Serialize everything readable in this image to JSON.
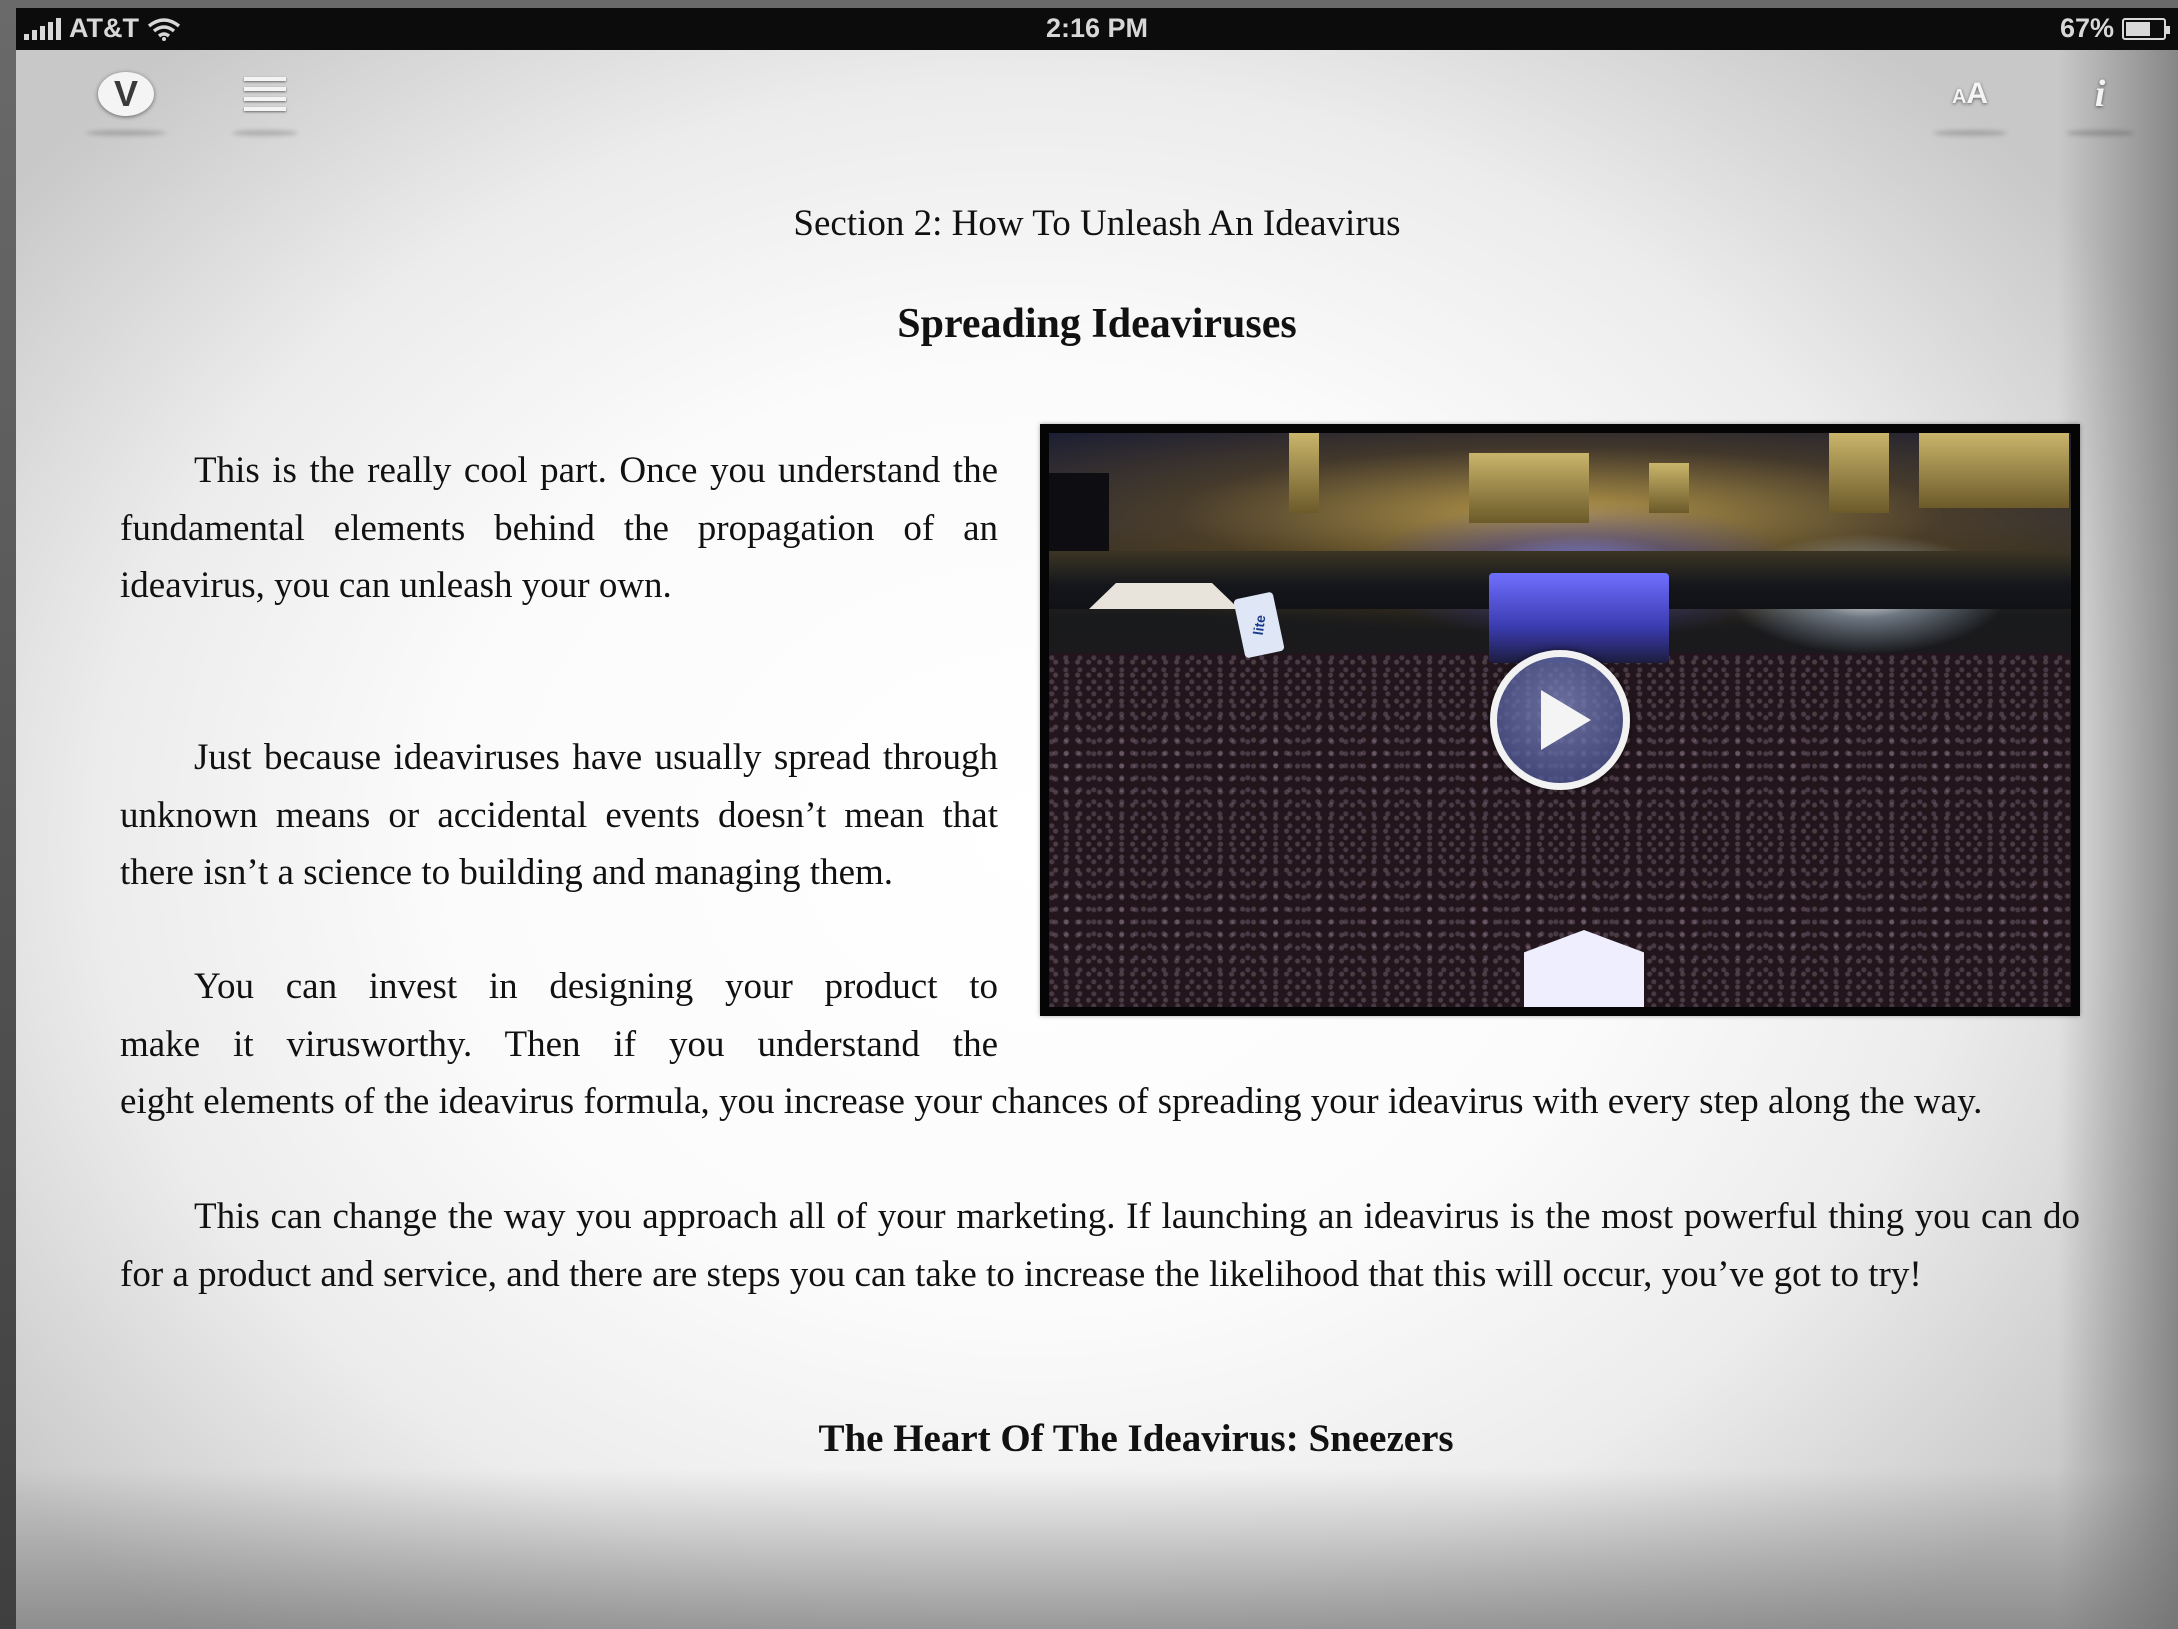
{
  "status_bar": {
    "carrier": "AT&T",
    "time": "2:16 PM",
    "battery": "67%",
    "battery_level": 0.67,
    "icons": [
      "signal-icon",
      "wifi-icon",
      "battery-icon"
    ]
  },
  "toolbar": {
    "logo_letter": "V",
    "font_small": "A",
    "font_big": "A",
    "info_label": "i",
    "icons": [
      "logo-icon",
      "table-of-contents-icon",
      "font-size-icon",
      "info-icon"
    ]
  },
  "content": {
    "section_title": "Section 2: How To Unleash An Ideavirus",
    "chapter_title": "Spreading Ideaviruses",
    "paragraphs": [
      "This is the really cool part. Once you understand the fundamental elements behind the propagation of an ideavirus, you can unleash your own.",
      "Just because ideaviruses have usually spread through unknown means or accidental events doesn’t mean that there isn’t a science to building and managing them.",
      "You can invest in designing your product to make it virusworthy. Then if you understand the eight elements of the ideavirus formula, you increase your chances of spreading your ideavirus with every step along the way.",
      "This can change the way you approach all of your marketing. If launching an ideavirus is the most powerful thing you can do for a product and service, and there are steps you can take to increase the likelihood that this will occur, you’ve got to try!"
    ],
    "p3_line1": "You can invest in designing your product to",
    "p3_line2": "make it virusworthy. Then if you understand the",
    "p3_rest": "eight elements of the ideavirus formula, you increase your chances of spreading your ideavirus with every step along the way.",
    "next_heading": "The Heart Of The Ideavirus: Sneezers"
  },
  "video": {
    "banner_text": "lite",
    "play_icon": "play-icon"
  }
}
